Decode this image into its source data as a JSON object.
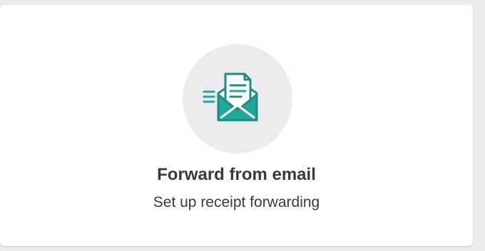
{
  "card": {
    "title": "Forward from email",
    "subtitle": "Set up receipt forwarding",
    "icon": "envelope-with-document-icon"
  },
  "colors": {
    "page_background": "#ececee",
    "card_background": "#ffffff",
    "icon_circle": "#ececee",
    "icon_accent": "#1fa99a",
    "icon_stroke": "#1c8c84",
    "text": "#393a3d"
  }
}
